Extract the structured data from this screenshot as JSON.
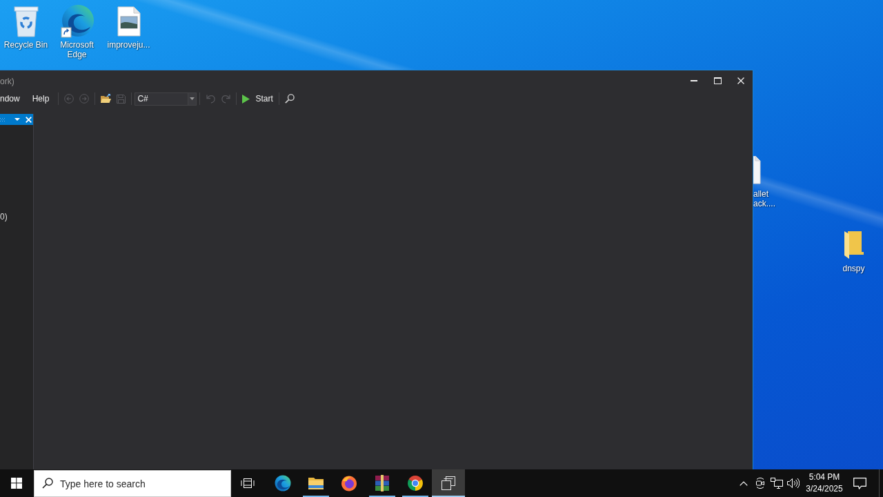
{
  "desktop": {
    "icons": [
      {
        "kind": "recycle-bin",
        "label": "Recycle Bin"
      },
      {
        "kind": "edge",
        "label": "Microsoft Edge"
      },
      {
        "kind": "image-file",
        "label": "improveju..."
      },
      {
        "kind": "file",
        "label": "allet ack...."
      },
      {
        "kind": "folder",
        "label": "dnspy"
      }
    ]
  },
  "window": {
    "title": "ork)",
    "menu": [
      "ndow",
      "Help"
    ],
    "toolbar": [
      {
        "items": [
          {
            "kind": "back",
            "disabled": true
          },
          {
            "kind": "forward",
            "disabled": true
          }
        ]
      },
      {
        "items": [
          {
            "kind": "open",
            "disabled": false
          },
          {
            "kind": "save",
            "disabled": true
          }
        ]
      },
      {
        "items": [
          {
            "kind": "combo",
            "value": "C#"
          }
        ]
      },
      {
        "items": [
          {
            "kind": "undo",
            "disabled": true
          },
          {
            "kind": "redo",
            "disabled": true
          }
        ]
      },
      {
        "items": [
          {
            "kind": "run",
            "label": "Start",
            "disabled": false
          }
        ]
      },
      {
        "items": [
          {
            "kind": "find",
            "disabled": false
          }
        ]
      }
    ],
    "panel": {
      "text": "0)"
    }
  },
  "taskbar": {
    "search": {
      "placeholder": "Type here to search"
    },
    "apps": [
      {
        "kind": "edge",
        "running": false,
        "selected": false
      },
      {
        "kind": "explorer",
        "running": true,
        "selected": false
      },
      {
        "kind": "firefox",
        "running": false,
        "selected": false
      },
      {
        "kind": "winrar",
        "running": true,
        "selected": false
      },
      {
        "kind": "chrome",
        "running": true,
        "selected": false
      },
      {
        "kind": "window-stack",
        "running": true,
        "selected": true
      }
    ],
    "clock": {
      "time": "5:04 PM",
      "date": "3/24/2025"
    }
  }
}
